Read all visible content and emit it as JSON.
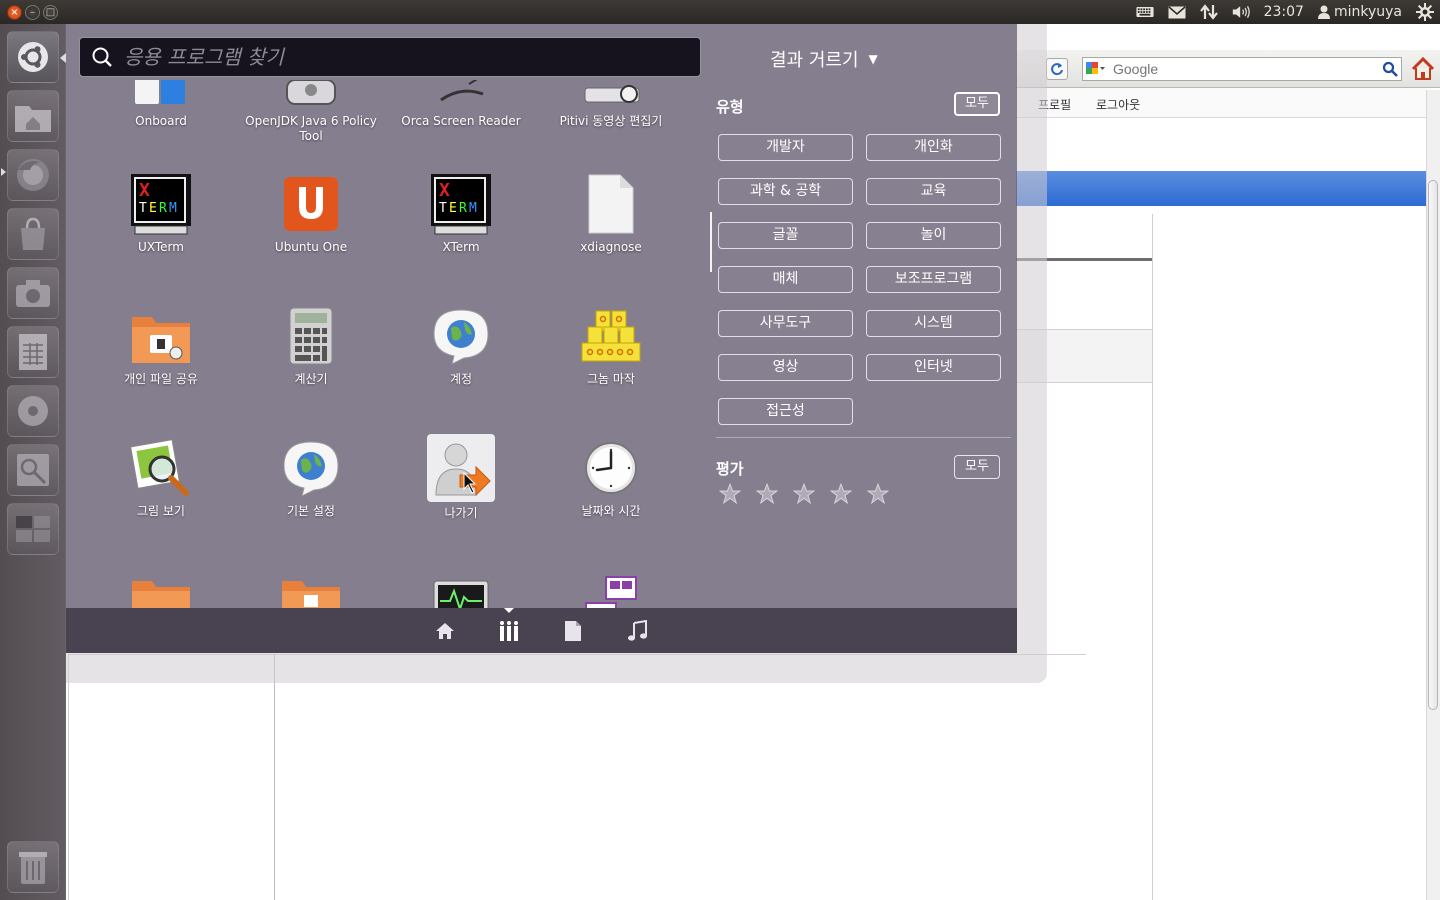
{
  "panel": {
    "clock": "23:07",
    "user": "minkyuya"
  },
  "browser": {
    "search_placeholder": "Google",
    "nav_links": [
      "프로필",
      "로그아웃"
    ]
  },
  "dash": {
    "search_placeholder": "응용 프로그램 찾기",
    "filter_toggle": "결과 거르기",
    "apps": [
      {
        "label": "Onboard",
        "icon": "onboard-icon"
      },
      {
        "label": "OpenJDK Java 6 Policy Tool",
        "icon": "java-policy-icon"
      },
      {
        "label": "Orca Screen Reader",
        "icon": "orca-icon"
      },
      {
        "label": "Pitivi 동영상 편집기",
        "icon": "pitivi-icon"
      },
      {
        "label": "UXTerm",
        "icon": "xterm-icon"
      },
      {
        "label": "Ubuntu One",
        "icon": "ubuntu-one-icon"
      },
      {
        "label": "XTerm",
        "icon": "xterm-icon"
      },
      {
        "label": "xdiagnose",
        "icon": "document-icon"
      },
      {
        "label": "개인 파일 공유",
        "icon": "folder-share-icon"
      },
      {
        "label": "계산기",
        "icon": "calculator-icon"
      },
      {
        "label": "계정",
        "icon": "globe-chat-icon"
      },
      {
        "label": "그놈 마작",
        "icon": "mahjongg-icon"
      },
      {
        "label": "그림 보기",
        "icon": "image-viewer-icon"
      },
      {
        "label": "기본 설정",
        "icon": "globe-chat-icon"
      },
      {
        "label": "나가기",
        "icon": "logout-icon"
      },
      {
        "label": "날짜와 시간",
        "icon": "clock-icon"
      },
      {
        "label": "",
        "icon": "folder-icon"
      },
      {
        "label": "",
        "icon": "folder-icon"
      },
      {
        "label": "",
        "icon": "system-monitor-icon"
      },
      {
        "label": "",
        "icon": "display-icon"
      }
    ],
    "filters": {
      "type_title": "유형",
      "all_label": "모두",
      "categories": [
        "개발자",
        "개인화",
        "과학 & 공학",
        "교육",
        "글꼴",
        "놀이",
        "매체",
        "보조프로그램",
        "사무도구",
        "시스템",
        "영상",
        "인터넷",
        "접근성"
      ],
      "rating_title": "평가",
      "rating_all_label": "모두"
    },
    "lenses": [
      "home-lens",
      "applications-lens",
      "files-lens",
      "music-lens"
    ],
    "active_lens": "applications-lens"
  },
  "launcher": {
    "items": [
      "ubuntu-logo-icon",
      "home-folder-icon",
      "firefox-icon",
      "software-center-icon",
      "camera-icon",
      "spreadsheet-icon",
      "disk-icon",
      "image-icon",
      "workspace-icon",
      "trash-icon"
    ]
  }
}
